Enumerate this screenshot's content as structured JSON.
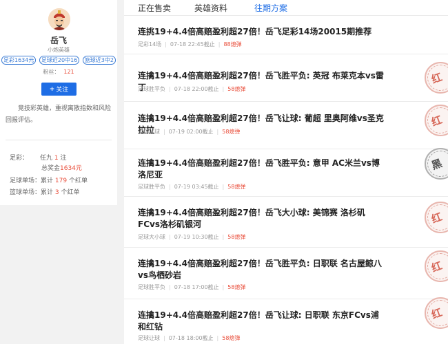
{
  "profile": {
    "name": "岳飞",
    "level": "小炮英雄",
    "badges": [
      "足彩1634元",
      "足球近20中16",
      "篮球近3中2"
    ],
    "fans_label": "粉丝：",
    "fans_count": "121",
    "follow_label": "关注",
    "bio": "竞技彩英雄，重视离散指数和风险回报评估。",
    "stats": {
      "row1_key": "足彩：",
      "row1_pre": "任九",
      "row1_num": "1",
      "row1_post": "注",
      "row2_pre": "总奖金",
      "row2_amount": "1634元",
      "row3_key": "足球单场：",
      "row3_pre": "累计",
      "row3_num": "179",
      "row3_post": "个红单",
      "row4_key": "篮球单场：",
      "row4_pre": "累计",
      "row4_num": "3",
      "row4_post": "个红单"
    }
  },
  "tabs": [
    "正在售卖",
    "英雄资料",
    "往期方案"
  ],
  "articles": [
    {
      "title": "连挑19+4.4倍高赔盈利超27倍！岳飞足彩14场20015期推荐",
      "category": "足彩14场",
      "time": "07-18 22:45截止",
      "price": "88熄弹",
      "stamp": ""
    },
    {
      "title": "连擒19+4.4倍高赔盈利超27倍！岳飞胜平负: 英冠 布莱克本vs雷丁",
      "category": "足球胜平负",
      "time": "07-18 22:00截止",
      "price": "58熄弹",
      "stamp": "红"
    },
    {
      "title": "连擒19+4.4倍高赔盈利超27倍！岳飞让球: 葡超 里奥阿维vs圣克拉拉",
      "category": "足球让球",
      "time": "07-19 02:00截止",
      "price": "58熄弹",
      "stamp": "红"
    },
    {
      "title": "连擒19+4.4倍高赔盈利超27倍！岳飞胜平负: 意甲 AC米兰vs博洛尼亚",
      "category": "足球胜平负",
      "time": "07-19 03:45截止",
      "price": "58熄弹",
      "stamp": "黑"
    },
    {
      "title": "连擒19+4.4倍高赔盈利超27倍！岳飞大小球: 美锦赛 洛杉矶FCvs洛杉矶银河",
      "category": "足球大小球",
      "time": "07-19 10:30截止",
      "price": "58熄弹",
      "stamp": "红"
    },
    {
      "title": "连擒19+4.4倍高赔盈利超27倍！岳飞胜平负: 日职联 名古屋鲸八vs鸟栖砂岩",
      "category": "足球胜平负",
      "time": "07-18 17:00截止",
      "price": "58熄弹",
      "stamp": "红"
    },
    {
      "title": "连擒19+4.4倍高赔盈利超27倍！岳飞让球: 日职联 东京FCvs浦和红钻",
      "category": "足球让球",
      "time": "07-18 18:00截止",
      "price": "58熄弹",
      "stamp": "红"
    }
  ]
}
